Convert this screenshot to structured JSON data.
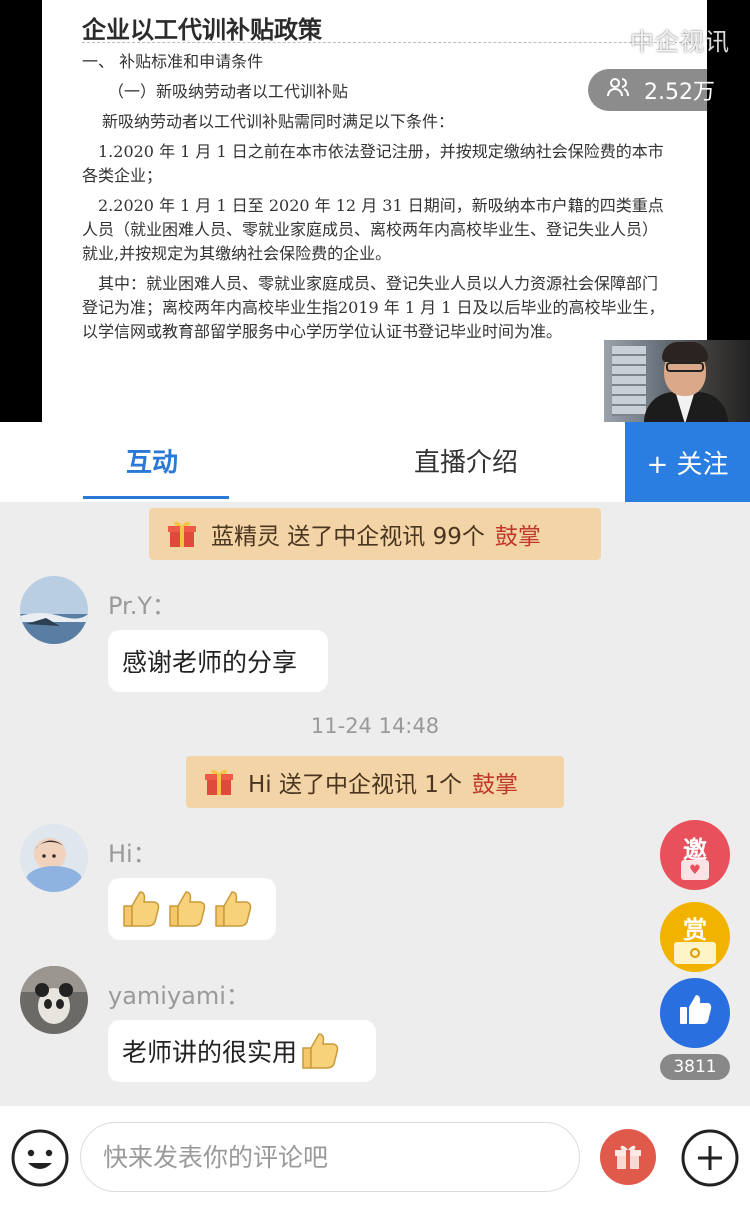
{
  "video": {
    "watermark": "中企视讯",
    "viewer_count": "2.52万",
    "slide": {
      "title": "企业以工代训补贴政策",
      "section": "一、 补贴标准和申请条件",
      "subsection": "（一）新吸纳劳动者以工代训补贴",
      "intro": "新吸纳劳动者以工代训补贴需同时满足以下条件：",
      "item1": "1.2020 年 1 月 1 日之前在本市依法登记注册，并按规定缴纳社会保险费的本市各类企业；",
      "item2": "2.2020 年 1 月 1 日至 2020 年 12 月 31 日期间，新吸纳本市户籍的四类重点人员（就业困难人员、零就业家庭成员、离校两年内高校毕业生、登记失业人员）就业,并按规定为其缴纳社会保险费的企业。",
      "note": "其中：就业困难人员、零就业家庭成员、登记失业人员以人力资源社会保障部门登记为准；离校两年内高校毕业生指2019 年 1 月 1 日及以后毕业的高校毕业生，以学信网或教育部留学服务中心学历学位认证书登记毕业时间为准。"
    }
  },
  "tabs": {
    "interact": "互动",
    "intro": "直播介绍"
  },
  "follow_label": "+ 关注",
  "chat": {
    "gift1": {
      "text": "蓝精灵 送了中企视讯 99个",
      "action": "鼓掌"
    },
    "msg1": {
      "user": "Pr.Y：",
      "text": "感谢老师的分享"
    },
    "timestamp": "11-24 14:48",
    "gift2": {
      "text": "Hi 送了中企视讯 1个",
      "action": "鼓掌"
    },
    "msg2": {
      "user": "Hi：",
      "emoji": "thumbs-up x3"
    },
    "msg3": {
      "user": "yamiyami：",
      "text": "老师讲的很实用"
    }
  },
  "side": {
    "invite": "邀",
    "reward": "赏",
    "like_count": "3811"
  },
  "bottom": {
    "placeholder": "快来发表你的评论吧"
  },
  "colors": {
    "accent": "#2a79d8",
    "follow_bg": "#2a7de1",
    "gift_bg": "#f3d4a6",
    "gift_highlight": "#c0392b"
  }
}
